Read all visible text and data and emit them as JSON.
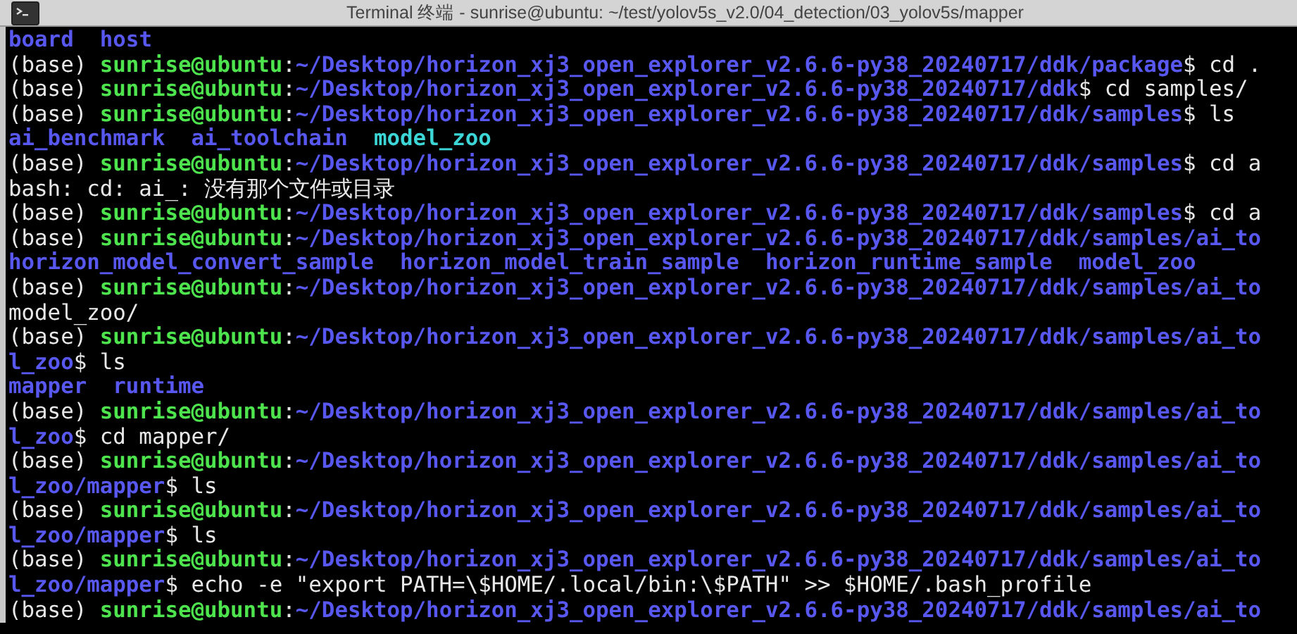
{
  "window": {
    "title": "Terminal 终端 - sunrise@ubuntu: ~/test/yolov5s_v2.0/04_detection/03_yolov5s/mapper"
  },
  "lines": [
    {
      "segments": [
        {
          "kind": "dir",
          "text": "board"
        },
        {
          "kind": "dir",
          "text": "host"
        }
      ]
    },
    {
      "segments": [
        {
          "kind": "plain",
          "text": "(base) "
        },
        {
          "kind": "user",
          "text": "sunrise@ubuntu"
        },
        {
          "kind": "plain",
          "text": ":"
        },
        {
          "kind": "path",
          "text": "~/Desktop/horizon_xj3_open_explorer_v2.6.6-py38_20240717/ddk/package"
        },
        {
          "kind": "plain",
          "text": "$ cd ."
        }
      ]
    },
    {
      "segments": [
        {
          "kind": "plain",
          "text": "(base) "
        },
        {
          "kind": "user",
          "text": "sunrise@ubuntu"
        },
        {
          "kind": "plain",
          "text": ":"
        },
        {
          "kind": "path",
          "text": "~/Desktop/horizon_xj3_open_explorer_v2.6.6-py38_20240717/ddk"
        },
        {
          "kind": "plain",
          "text": "$ cd samples/"
        }
      ]
    },
    {
      "segments": [
        {
          "kind": "plain",
          "text": "(base) "
        },
        {
          "kind": "user",
          "text": "sunrise@ubuntu"
        },
        {
          "kind": "plain",
          "text": ":"
        },
        {
          "kind": "path",
          "text": "~/Desktop/horizon_xj3_open_explorer_v2.6.6-py38_20240717/ddk/samples"
        },
        {
          "kind": "plain",
          "text": "$ ls"
        }
      ]
    },
    {
      "segments": [
        {
          "kind": "dir",
          "text": "ai_benchmark"
        },
        {
          "kind": "dir",
          "text": "ai_toolchain"
        },
        {
          "kind": "link",
          "text": "model_zoo"
        }
      ]
    },
    {
      "segments": [
        {
          "kind": "plain",
          "text": "(base) "
        },
        {
          "kind": "user",
          "text": "sunrise@ubuntu"
        },
        {
          "kind": "plain",
          "text": ":"
        },
        {
          "kind": "path",
          "text": "~/Desktop/horizon_xj3_open_explorer_v2.6.6-py38_20240717/ddk/samples"
        },
        {
          "kind": "plain",
          "text": "$ cd a"
        }
      ]
    },
    {
      "segments": [
        {
          "kind": "plain",
          "text": "bash: cd: ai_: 没有那个文件或目录"
        }
      ]
    },
    {
      "segments": [
        {
          "kind": "plain",
          "text": "(base) "
        },
        {
          "kind": "user",
          "text": "sunrise@ubuntu"
        },
        {
          "kind": "plain",
          "text": ":"
        },
        {
          "kind": "path",
          "text": "~/Desktop/horizon_xj3_open_explorer_v2.6.6-py38_20240717/ddk/samples"
        },
        {
          "kind": "plain",
          "text": "$ cd a"
        }
      ]
    },
    {
      "segments": [
        {
          "kind": "plain",
          "text": "(base) "
        },
        {
          "kind": "user",
          "text": "sunrise@ubuntu"
        },
        {
          "kind": "plain",
          "text": ":"
        },
        {
          "kind": "path",
          "text": "~/Desktop/horizon_xj3_open_explorer_v2.6.6-py38_20240717/ddk/samples/ai_to"
        }
      ]
    },
    {
      "segments": [
        {
          "kind": "dir",
          "text": "horizon_model_convert_sample"
        },
        {
          "kind": "dir",
          "text": "horizon_model_train_sample"
        },
        {
          "kind": "dir",
          "text": "horizon_runtime_sample"
        },
        {
          "kind": "dir",
          "text": "model_zoo"
        }
      ]
    },
    {
      "segments": [
        {
          "kind": "plain",
          "text": "(base) "
        },
        {
          "kind": "user",
          "text": "sunrise@ubuntu"
        },
        {
          "kind": "plain",
          "text": ":"
        },
        {
          "kind": "path",
          "text": "~/Desktop/horizon_xj3_open_explorer_v2.6.6-py38_20240717/ddk/samples/ai_to"
        }
      ]
    },
    {
      "segments": [
        {
          "kind": "plain",
          "text": "model_zoo/"
        }
      ]
    },
    {
      "segments": [
        {
          "kind": "plain",
          "text": "(base) "
        },
        {
          "kind": "user",
          "text": "sunrise@ubuntu"
        },
        {
          "kind": "plain",
          "text": ":"
        },
        {
          "kind": "path",
          "text": "~/Desktop/horizon_xj3_open_explorer_v2.6.6-py38_20240717/ddk/samples/ai_to"
        }
      ]
    },
    {
      "segments": [
        {
          "kind": "path",
          "text": "l_zoo"
        },
        {
          "kind": "plain",
          "text": "$ ls"
        }
      ]
    },
    {
      "segments": [
        {
          "kind": "dir",
          "text": "mapper"
        },
        {
          "kind": "dir",
          "text": "runtime"
        }
      ]
    },
    {
      "segments": [
        {
          "kind": "plain",
          "text": "(base) "
        },
        {
          "kind": "user",
          "text": "sunrise@ubuntu"
        },
        {
          "kind": "plain",
          "text": ":"
        },
        {
          "kind": "path",
          "text": "~/Desktop/horizon_xj3_open_explorer_v2.6.6-py38_20240717/ddk/samples/ai_to"
        }
      ]
    },
    {
      "segments": [
        {
          "kind": "path",
          "text": "l_zoo"
        },
        {
          "kind": "plain",
          "text": "$ cd mapper/"
        }
      ]
    },
    {
      "segments": [
        {
          "kind": "plain",
          "text": "(base) "
        },
        {
          "kind": "user",
          "text": "sunrise@ubuntu"
        },
        {
          "kind": "plain",
          "text": ":"
        },
        {
          "kind": "path",
          "text": "~/Desktop/horizon_xj3_open_explorer_v2.6.6-py38_20240717/ddk/samples/ai_to"
        }
      ]
    },
    {
      "segments": [
        {
          "kind": "path",
          "text": "l_zoo/mapper"
        },
        {
          "kind": "plain",
          "text": "$ ls"
        }
      ]
    },
    {
      "segments": [
        {
          "kind": "plain",
          "text": "(base) "
        },
        {
          "kind": "user",
          "text": "sunrise@ubuntu"
        },
        {
          "kind": "plain",
          "text": ":"
        },
        {
          "kind": "path",
          "text": "~/Desktop/horizon_xj3_open_explorer_v2.6.6-py38_20240717/ddk/samples/ai_to"
        }
      ]
    },
    {
      "segments": [
        {
          "kind": "path",
          "text": "l_zoo/mapper"
        },
        {
          "kind": "plain",
          "text": "$ ls"
        }
      ]
    },
    {
      "segments": [
        {
          "kind": "plain",
          "text": "(base) "
        },
        {
          "kind": "user",
          "text": "sunrise@ubuntu"
        },
        {
          "kind": "plain",
          "text": ":"
        },
        {
          "kind": "path",
          "text": "~/Desktop/horizon_xj3_open_explorer_v2.6.6-py38_20240717/ddk/samples/ai_to"
        }
      ]
    },
    {
      "segments": [
        {
          "kind": "path",
          "text": "l_zoo/mapper"
        },
        {
          "kind": "plain",
          "text": "$ echo -e \"export PATH=\\$HOME/.local/bin:\\$PATH\" >> $HOME/.bash_profile"
        }
      ]
    },
    {
      "segments": [
        {
          "kind": "plain",
          "text": "(base) "
        },
        {
          "kind": "user",
          "text": "sunrise@ubuntu"
        },
        {
          "kind": "plain",
          "text": ":"
        },
        {
          "kind": "path",
          "text": "~/Desktop/horizon_xj3_open_explorer_v2.6.6-py38_20240717/ddk/samples/ai_to"
        }
      ]
    }
  ]
}
